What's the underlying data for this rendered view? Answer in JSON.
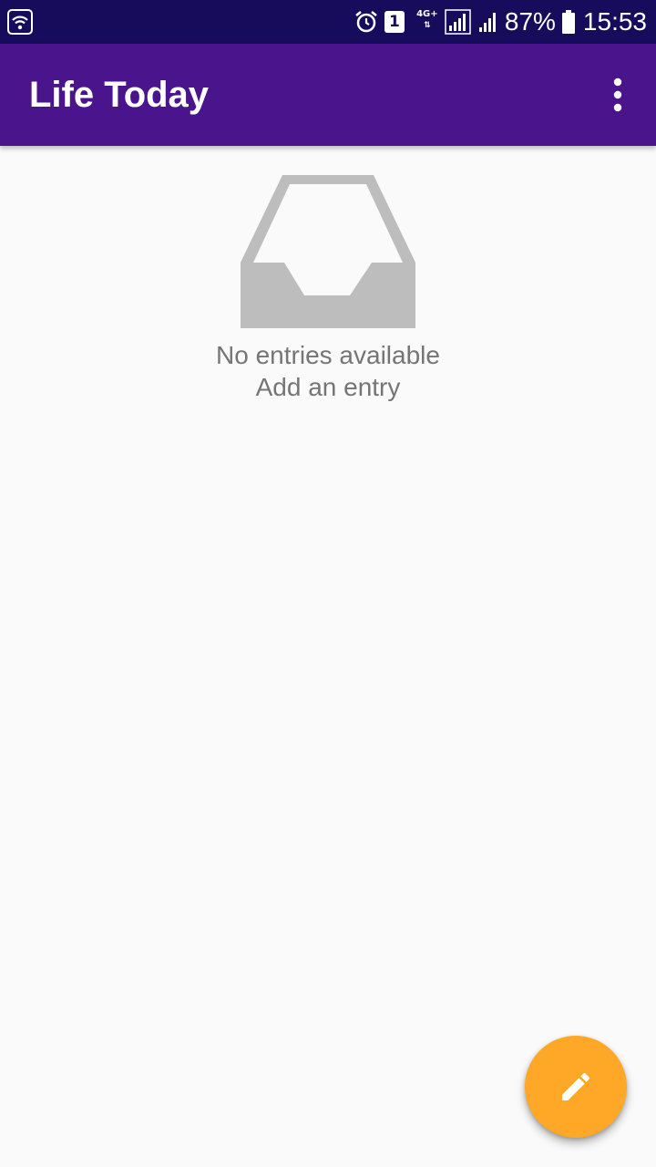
{
  "status_bar": {
    "sim_slot": "1",
    "network_type": "4G+",
    "battery_percent": "87%",
    "time": "15:53",
    "icons": [
      "wifi-icon",
      "alarm-icon",
      "sim-badge",
      "network-type-icon",
      "signal-icon",
      "signal-icon",
      "battery-icon"
    ]
  },
  "app_bar": {
    "title": "Life Today",
    "menu_icon": "more-vert-icon"
  },
  "empty_state": {
    "icon": "inbox-icon",
    "title": "No entries available",
    "subtitle": "Add an entry"
  },
  "fab": {
    "icon": "edit-pencil-icon"
  },
  "colors": {
    "status_bar": "#170b5c",
    "app_bar": "#4a148c",
    "background": "#fafafa",
    "empty_icon": "#bdbdbd",
    "empty_text": "#757575",
    "fab": "#ffa726"
  }
}
